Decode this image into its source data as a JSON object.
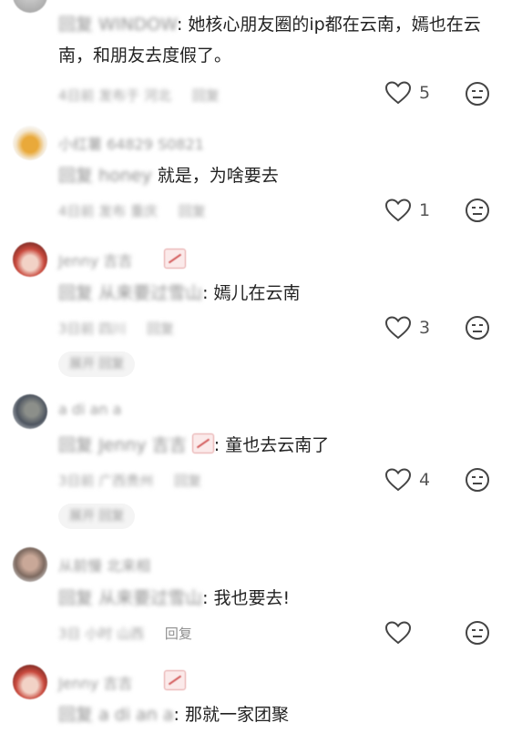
{
  "comments": [
    {
      "reply_prefix": "回复",
      "reply_to": "WINDOW",
      "text": "她核心朋友圈的ip都在云南，嫣也在云南，和朋友去度假了。",
      "time": "4日前 发布于 河北",
      "reply_button": "回复",
      "likes": "5"
    },
    {
      "username": "小红薯 64829 S0821",
      "reply_prefix": "回复",
      "reply_to": "honey",
      "text": "就是，为啥要去",
      "time": "4日前 发布 重庆",
      "reply_button": "回复",
      "likes": "1"
    },
    {
      "username": "Jenny 吉吉",
      "reply_prefix": "回复",
      "reply_to": "从来要过雪山",
      "text": "嫣儿在云南",
      "time": "3日前 四川",
      "reply_button": "回复",
      "likes": "3",
      "expand": "展开 回复"
    },
    {
      "username": "a di an a",
      "reply_prefix": "回复",
      "reply_to": "Jenny 吉吉",
      "text": "童也去云南了",
      "time": "3日前 广西贵州",
      "reply_button": "回复",
      "likes": "4",
      "expand": "展开 回复"
    },
    {
      "username": "从前慢 北来相",
      "reply_prefix": "回复",
      "reply_to": "从来要过雪山",
      "text": "我也要去!",
      "time": "3日 小时 山西",
      "reply_button": "回复",
      "likes": ""
    },
    {
      "username": "Jenny 吉吉",
      "reply_prefix": "回复",
      "reply_to": "a di an a",
      "text": "那就一家团聚"
    }
  ]
}
